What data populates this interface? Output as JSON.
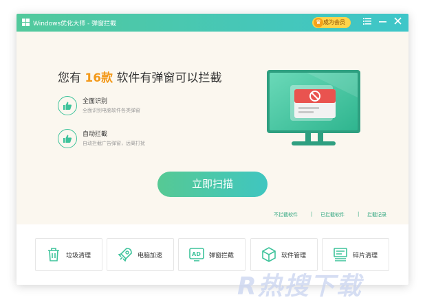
{
  "titlebar": {
    "title": "Windows优化大师 - 弹窗拦截",
    "vip_label": "成为会员",
    "menu_icon": "menu-icon",
    "minimize_icon": "minimize-icon",
    "close_icon": "close-icon"
  },
  "headline": {
    "prefix": "您有",
    "count": "16款",
    "suffix": "软件有弹窗可以拦截"
  },
  "features": [
    {
      "title": "全面识别",
      "desc": "全面识别电脑软件各类弹窗",
      "icon": "thumbs-up-icon"
    },
    {
      "title": "自动拦截",
      "desc": "自动拦截广告弹窗，远离打扰",
      "icon": "thumbs-up-icon"
    }
  ],
  "scan_button": "立即扫描",
  "links": [
    {
      "label": "不拦截软件"
    },
    {
      "label": "已拦截软件"
    },
    {
      "label": "拦截记录"
    }
  ],
  "link_separator": "|",
  "tools": [
    {
      "label": "垃圾清理",
      "icon": "trash-icon"
    },
    {
      "label": "电脑加速",
      "icon": "rocket-icon"
    },
    {
      "label": "弹窗拦截",
      "icon": "ad-block-icon"
    },
    {
      "label": "软件管理",
      "icon": "box-icon"
    },
    {
      "label": "碎片清理",
      "icon": "defrag-icon"
    }
  ],
  "watermark": "R热搜下载",
  "colors": {
    "accent_green": "#3ec39b",
    "highlight_orange": "#f39a1c",
    "vip_yellow": "#ffd44a",
    "content_bg": "#fbf7ef"
  }
}
